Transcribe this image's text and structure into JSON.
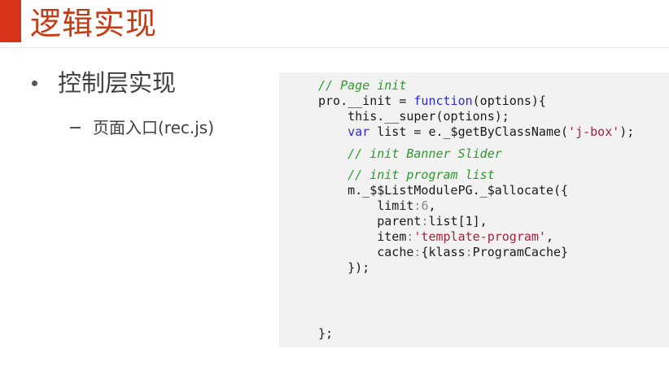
{
  "slide": {
    "title": "逻辑实现",
    "bullet": {
      "text": "控制层实现"
    },
    "sub_bullet": {
      "text": "页面入口(rec.js)"
    }
  },
  "code_panel": {
    "lines": [
      [
        {
          "t": "// Page init",
          "c": "comment"
        }
      ],
      [
        {
          "t": "pro.__init = ",
          "c": "plain"
        },
        {
          "t": "function",
          "c": "keyword"
        },
        {
          "t": "(options){",
          "c": "plain"
        }
      ],
      [
        {
          "t": "    this.__super(options);",
          "c": "plain"
        }
      ],
      [
        {
          "t": "    ",
          "c": "plain"
        },
        {
          "t": "var",
          "c": "keyword"
        },
        {
          "t": " list = e._$getByClassName(",
          "c": "plain"
        },
        {
          "t": "'j-box'",
          "c": "string"
        },
        {
          "t": ");",
          "c": "plain"
        }
      ],
      [
        {
          "t": "    // init Banner Slider",
          "c": "comment"
        }
      ],
      [
        {
          "t": "    // init program list",
          "c": "comment"
        }
      ],
      [
        {
          "t": "    m._$$ListModulePG._$allocate({",
          "c": "plain"
        }
      ],
      [
        {
          "t": "        limit",
          "c": "plain"
        },
        {
          "t": ":",
          "c": "punct"
        },
        {
          "t": "6",
          "c": "number"
        },
        {
          "t": ",",
          "c": "plain"
        }
      ],
      [
        {
          "t": "        parent",
          "c": "plain"
        },
        {
          "t": ":",
          "c": "punct"
        },
        {
          "t": "list[1],",
          "c": "plain"
        }
      ],
      [
        {
          "t": "        item",
          "c": "plain"
        },
        {
          "t": ":",
          "c": "punct"
        },
        {
          "t": "'template-program'",
          "c": "string"
        },
        {
          "t": ",",
          "c": "plain"
        }
      ],
      [
        {
          "t": "        cache",
          "c": "plain"
        },
        {
          "t": ":",
          "c": "punct"
        },
        {
          "t": "{klass",
          "c": "plain"
        },
        {
          "t": ":",
          "c": "punct"
        },
        {
          "t": "ProgramCache}",
          "c": "plain"
        }
      ],
      [
        {
          "t": "    });",
          "c": "plain"
        }
      ],
      [
        {
          "t": "};",
          "c": "plain"
        }
      ]
    ]
  }
}
